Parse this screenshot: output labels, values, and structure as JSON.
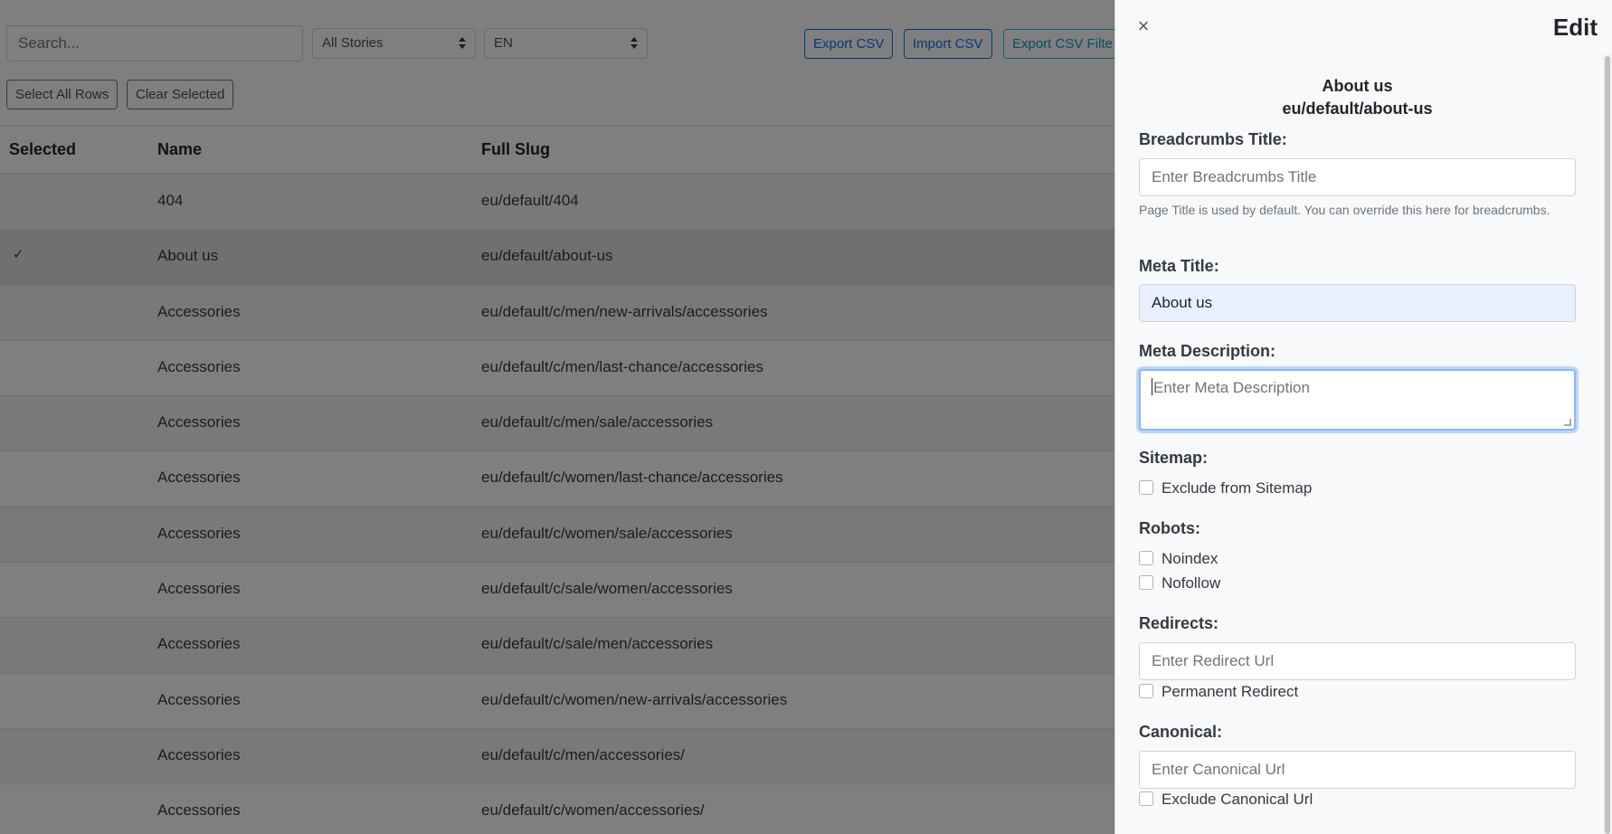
{
  "toolbar": {
    "search_placeholder": "Search...",
    "stories_select": "All Stories",
    "language_select": "EN",
    "export_csv": "Export CSV",
    "import_csv": "Import CSV",
    "export_csv_filtered": "Export CSV Filte",
    "select_all_rows": "Select All Rows",
    "clear_selected": "Clear Selected"
  },
  "table": {
    "headers": {
      "selected": "Selected",
      "name": "Name",
      "full_slug": "Full Slug"
    },
    "check_glyph": "✓",
    "rows": [
      {
        "selected": false,
        "name": "404",
        "slug": "eu/default/404"
      },
      {
        "selected": true,
        "name": "About us",
        "slug": "eu/default/about-us"
      },
      {
        "selected": false,
        "name": "Accessories",
        "slug": "eu/default/c/men/new-arrivals/accessories"
      },
      {
        "selected": false,
        "name": "Accessories",
        "slug": "eu/default/c/men/last-chance/accessories"
      },
      {
        "selected": false,
        "name": "Accessories",
        "slug": "eu/default/c/men/sale/accessories"
      },
      {
        "selected": false,
        "name": "Accessories",
        "slug": "eu/default/c/women/last-chance/accessories"
      },
      {
        "selected": false,
        "name": "Accessories",
        "slug": "eu/default/c/women/sale/accessories"
      },
      {
        "selected": false,
        "name": "Accessories",
        "slug": "eu/default/c/sale/women/accessories"
      },
      {
        "selected": false,
        "name": "Accessories",
        "slug": "eu/default/c/sale/men/accessories"
      },
      {
        "selected": false,
        "name": "Accessories",
        "slug": "eu/default/c/women/new-arrivals/accessories"
      },
      {
        "selected": false,
        "name": "Accessories",
        "slug": "eu/default/c/men/accessories/"
      },
      {
        "selected": false,
        "name": "Accessories",
        "slug": "eu/default/c/women/accessories/"
      }
    ]
  },
  "drawer": {
    "close_glyph": "×",
    "title": "Edit",
    "story_name": "About us",
    "story_slug": "eu/default/about-us",
    "breadcrumbs_label": "Breadcrumbs Title:",
    "breadcrumbs_placeholder": "Enter Breadcrumbs Title",
    "breadcrumbs_help": "Page Title is used by default. You can override this here for breadcrumbs.",
    "meta_title_label": "Meta Title:",
    "meta_title_value": "About us",
    "meta_description_label": "Meta Description:",
    "meta_description_placeholder": "Enter Meta Description",
    "sitemap_label": "Sitemap:",
    "exclude_sitemap": "Exclude from Sitemap",
    "robots_label": "Robots:",
    "noindex": "Noindex",
    "nofollow": "Nofollow",
    "redirects_label": "Redirects:",
    "redirect_placeholder": "Enter Redirect Url",
    "permanent_redirect": "Permanent Redirect",
    "canonical_label": "Canonical:",
    "canonical_placeholder": "Enter Canonical Url",
    "exclude_canonical": "Exclude Canonical Url"
  },
  "colors": {
    "primary": "#0d6efd",
    "overlay": "rgba(0,0,0,0.5)",
    "focus_border": "#86b7fe"
  }
}
